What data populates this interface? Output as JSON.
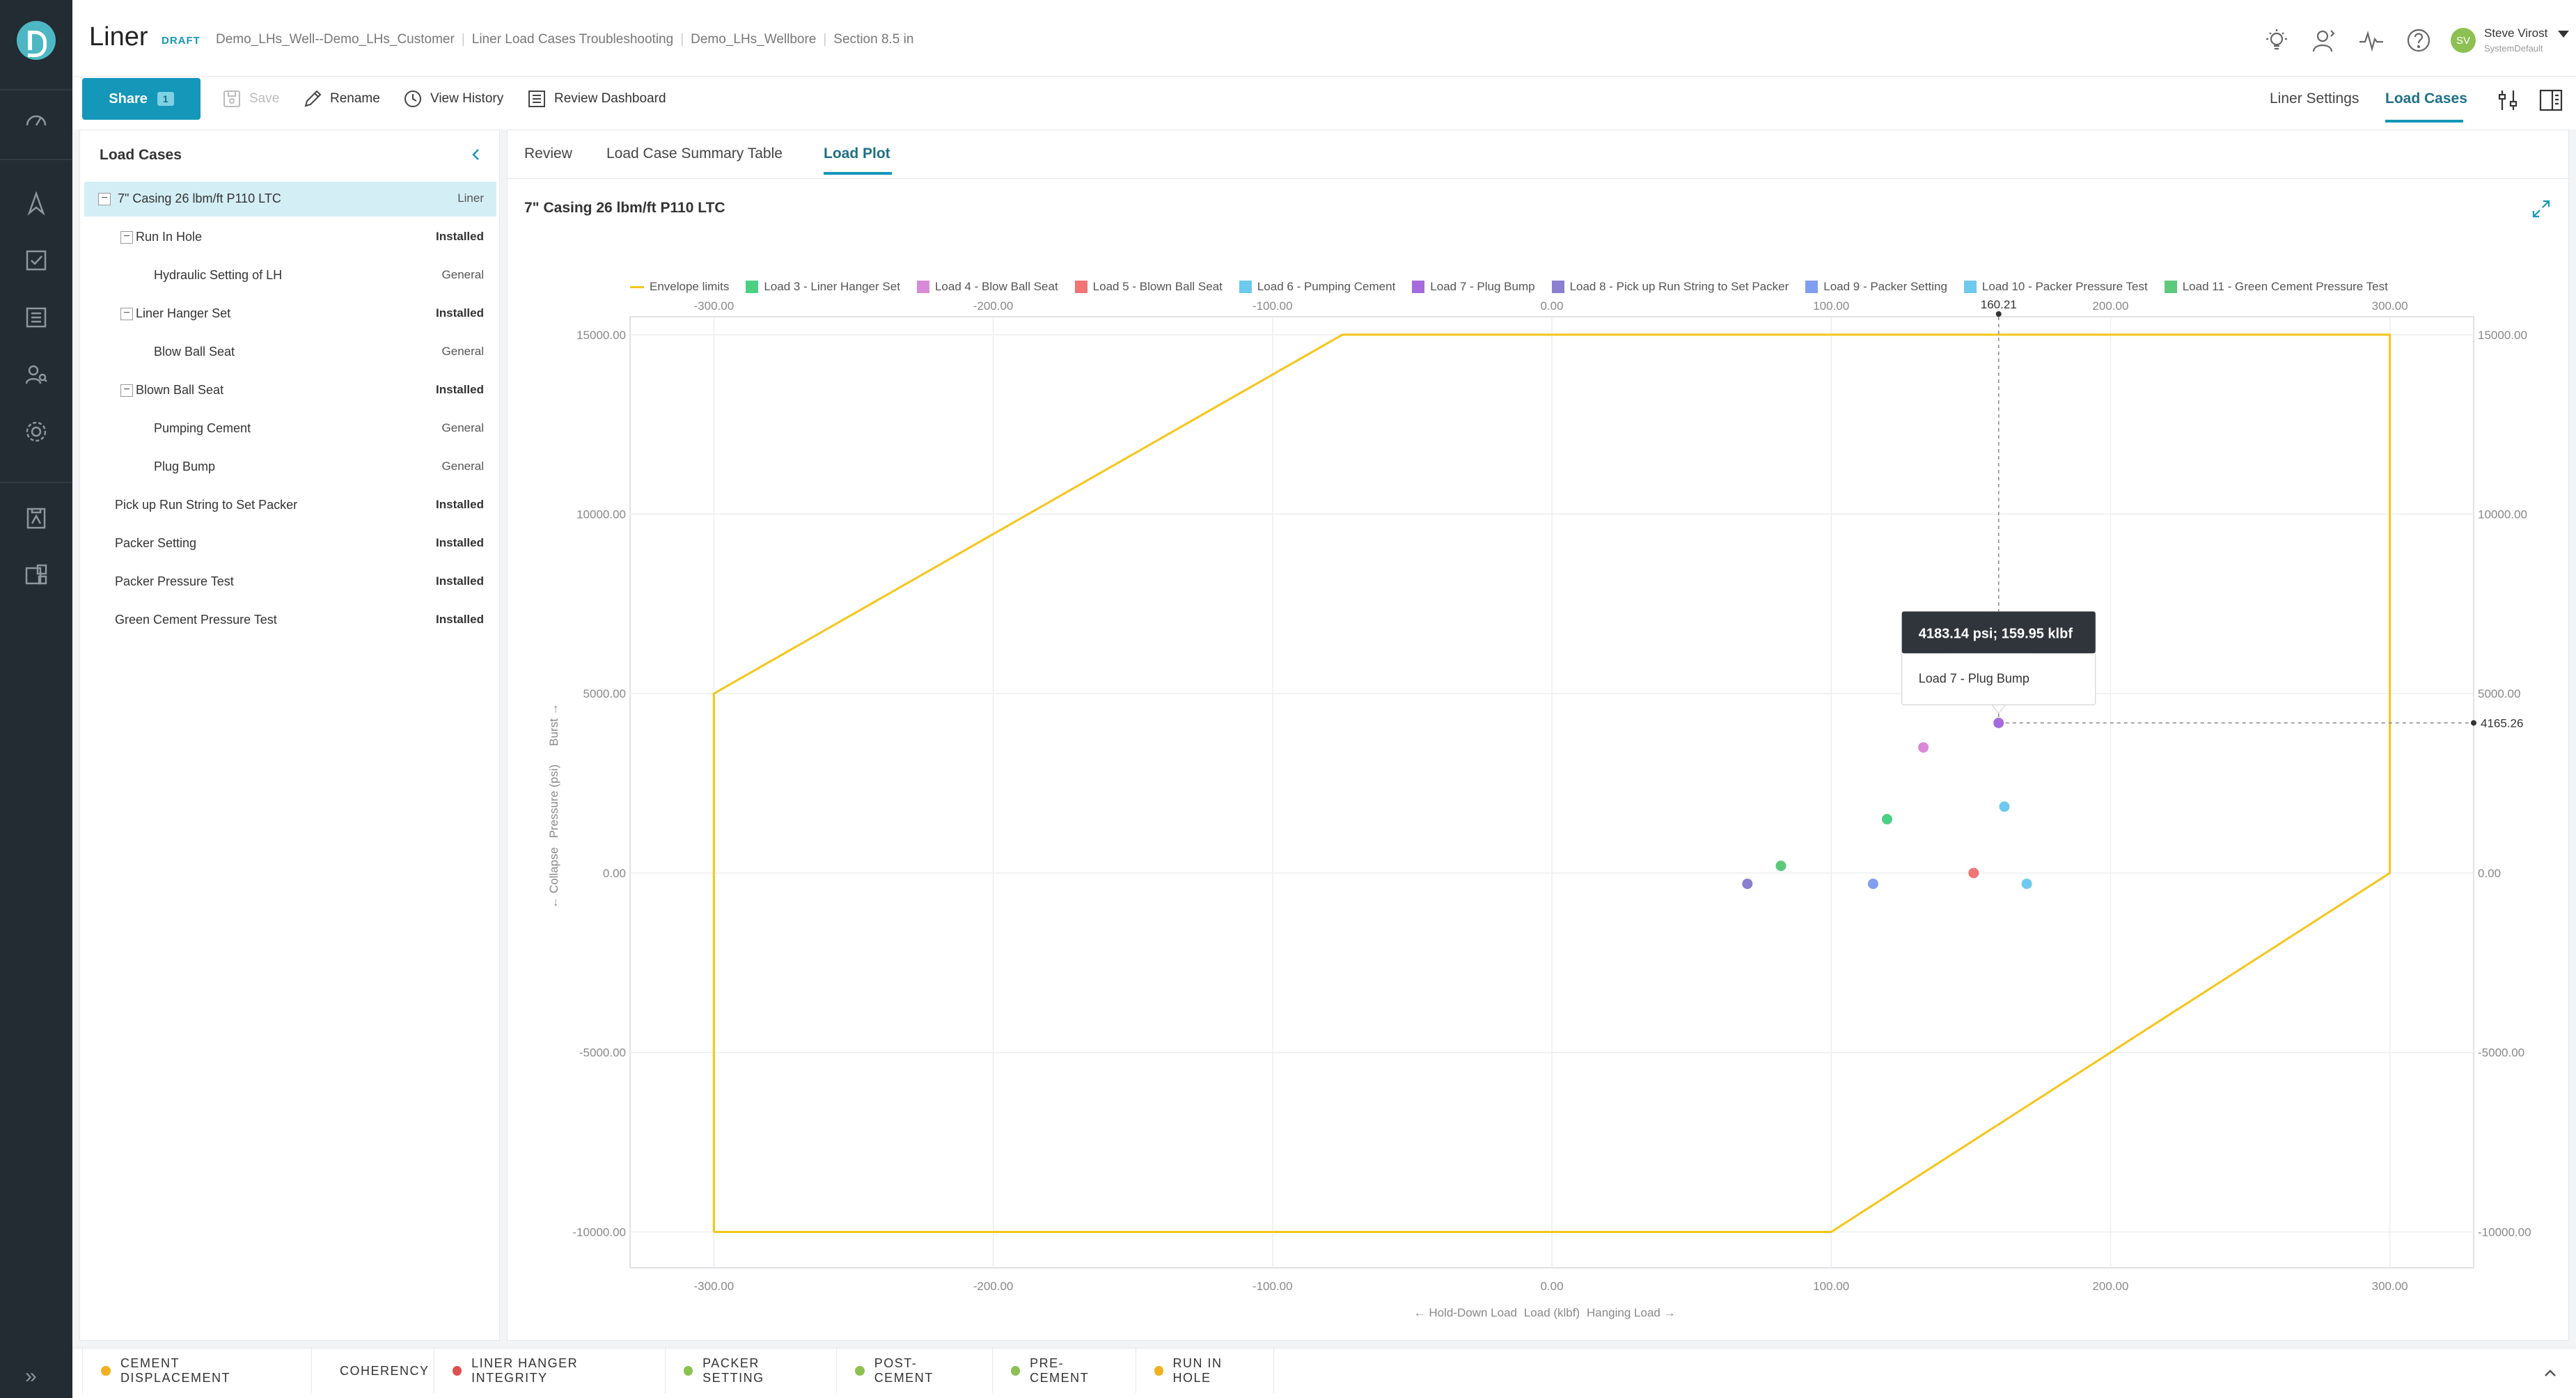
{
  "app": {
    "title": "Liner",
    "badge": "DRAFT",
    "breadcrumbs": [
      "Demo_LHs_Well--Demo_LHs_Customer",
      "Liner Load Cases Troubleshooting",
      "Demo_LHs_Wellbore",
      "Section 8.5 in"
    ]
  },
  "user": {
    "initials": "SV",
    "name": "Steve Virost",
    "role": "SystemDefault"
  },
  "toolbar": {
    "share_label": "Share",
    "share_count": "1",
    "save_label": "Save",
    "rename_label": "Rename",
    "history_label": "View History",
    "dashboard_label": "Review Dashboard",
    "right_tabs": [
      "Liner Settings",
      "Load Cases"
    ]
  },
  "load_cases": {
    "title": "Load Cases",
    "rows": [
      {
        "label": "7\" Casing 26 lbm/ft P110 LTC",
        "status": "Liner",
        "level": 0,
        "toggle": "−",
        "selected": true
      },
      {
        "label": "Run In Hole",
        "status": "Installed",
        "level": 1,
        "toggle": "−"
      },
      {
        "label": "Hydraulic Setting of LH",
        "status": "General",
        "level": 2
      },
      {
        "label": "Liner Hanger Set",
        "status": "Installed",
        "level": 1,
        "toggle": "−"
      },
      {
        "label": "Blow Ball Seat",
        "status": "General",
        "level": 2
      },
      {
        "label": "Blown Ball Seat",
        "status": "Installed",
        "level": 1,
        "toggle": "−"
      },
      {
        "label": "Pumping Cement",
        "status": "General",
        "level": 2
      },
      {
        "label": "Plug Bump",
        "status": "General",
        "level": 2
      },
      {
        "label": "Pick up Run String to Set Packer",
        "status": "Installed",
        "level": 0
      },
      {
        "label": "Packer Setting",
        "status": "Installed",
        "level": 0
      },
      {
        "label": "Packer Pressure Test",
        "status": "Installed",
        "level": 0
      },
      {
        "label": "Green Cement Pressure Test",
        "status": "Installed",
        "level": 0
      }
    ]
  },
  "main": {
    "tabs": [
      "Review",
      "Load Case Summary Table",
      "Load Plot"
    ],
    "plot_title": "7\" Casing 26 lbm/ft P110 LTC"
  },
  "chart_data": {
    "type": "scatter",
    "title": "7\" Casing 26 lbm/ft P110 LTC",
    "xlabel": "Load (klbf)",
    "xlabel_left": "← Hold-Down Load",
    "xlabel_right": "Hanging Load →",
    "ylabel": "Pressure (psi)",
    "ylabel_low": "← Collapse",
    "ylabel_high": "Burst →",
    "xlim": [
      -330,
      330
    ],
    "ylim": [
      -11000,
      15500
    ],
    "x_ticks": [
      "-300.00",
      "-200.00",
      "-100.00",
      "0.00",
      "100.00",
      "200.00",
      "300.00"
    ],
    "x_tick_values": [
      -300,
      -200,
      -100,
      0,
      100,
      200,
      300
    ],
    "y_ticks": [
      "-10000.00",
      "-5000.00",
      "0.00",
      "5000.00",
      "10000.00",
      "15000.00"
    ],
    "y_tick_values": [
      -10000,
      -5000,
      0,
      5000,
      10000,
      15000
    ],
    "grid": true,
    "legend_position": "top",
    "envelope": {
      "name": "Envelope limits",
      "color": "#f5c518",
      "points": [
        [
          -300,
          -10000
        ],
        [
          -300,
          5000
        ],
        [
          -75,
          15000
        ],
        [
          300,
          15000
        ],
        [
          300,
          0
        ],
        [
          100,
          -10000
        ],
        [
          -300,
          -10000
        ]
      ]
    },
    "series": [
      {
        "name": "Load 3 - Liner Hanger Set",
        "color": "#4ccf85",
        "x": 120,
        "y": 1500
      },
      {
        "name": "Load 4 - Blow Ball Seat",
        "color": "#d88ad8",
        "x": 133,
        "y": 3500
      },
      {
        "name": "Load 5 - Blown Ball Seat",
        "color": "#f07575",
        "x": 151,
        "y": 0
      },
      {
        "name": "Load 6 - Pumping Cement",
        "color": "#6ec9ee",
        "x": 162,
        "y": 1850
      },
      {
        "name": "Load 7 - Plug Bump",
        "color": "#a56bde",
        "x": 159.95,
        "y": 4183.14
      },
      {
        "name": "Load 8 - Pick up Run String to Set Packer",
        "color": "#8b7fd0",
        "x": 70,
        "y": -300
      },
      {
        "name": "Load 9 - Packer Setting",
        "color": "#7f9ef0",
        "x": 115,
        "y": -300
      },
      {
        "name": "Load 10 - Packer Pressure Test",
        "color": "#6ec9ee",
        "x": 170,
        "y": -300
      },
      {
        "name": "Load 11 - Green Cement Pressure Test",
        "color": "#5cc97c",
        "x": 82,
        "y": 200
      }
    ],
    "crosshair": {
      "x_label": "160.21",
      "y_label": "4165.26"
    },
    "tooltip": {
      "value": "4183.14 psi; 159.95 klbf",
      "series": "Load 7 - Plug Bump"
    }
  },
  "bottom_tabs": [
    {
      "label": "CEMENT DISPLACEMENT",
      "color": "#f0b020"
    },
    {
      "label": "COHERENCY",
      "color": "#8cc152"
    },
    {
      "label": "LINER HANGER INTEGRITY",
      "color": "#e05050"
    },
    {
      "label": "PACKER SETTING",
      "color": "#8cc152"
    },
    {
      "label": "POST-CEMENT",
      "color": "#8cc152"
    },
    {
      "label": "PRE-CEMENT",
      "color": "#8cc152"
    },
    {
      "label": "RUN IN HOLE",
      "color": "#f0b020"
    }
  ]
}
